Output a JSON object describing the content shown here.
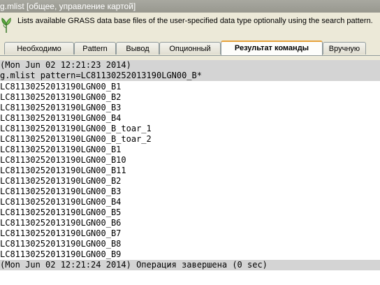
{
  "window": {
    "title": "g.mlist [общее, управление картой]"
  },
  "info": {
    "description": "Lists available GRASS data base files of the user-specified data type optionally using the search pattern.",
    "icon": "grass-leaf-icon"
  },
  "tabs": [
    {
      "label": "Необходимо",
      "active": false
    },
    {
      "label": "Pattern",
      "active": false
    },
    {
      "label": "Вывод",
      "active": false
    },
    {
      "label": "Опционный",
      "active": false
    },
    {
      "label": "Результат команды",
      "active": true
    },
    {
      "label": "Вручную",
      "active": false
    }
  ],
  "console": {
    "start_time": "(Mon Jun 02 12:21:23 2014)",
    "command": "g.mlist pattern=LC81130252013190LGN00_B*",
    "results": [
      "LC81130252013190LGN00_B1",
      "LC81130252013190LGN00_B2",
      "LC81130252013190LGN00_B3",
      "LC81130252013190LGN00_B4",
      "LC81130252013190LGN00_B_toar_1",
      "LC81130252013190LGN00_B_toar_2",
      "LC81130252013190LGN00_B1",
      "LC81130252013190LGN00_B10",
      "LC81130252013190LGN00_B11",
      "LC81130252013190LGN00_B2",
      "LC81130252013190LGN00_B3",
      "LC81130252013190LGN00_B4",
      "LC81130252013190LGN00_B5",
      "LC81130252013190LGN00_B6",
      "LC81130252013190LGN00_B7",
      "LC81130252013190LGN00_B8",
      "LC81130252013190LGN00_B9"
    ],
    "end_status": "(Mon Jun 02 12:21:24 2014) Операция завершена (0 sec)"
  },
  "colors": {
    "titlebar": "#a0a098",
    "highlight": "#d4d4d4",
    "active_tab_accent": "#e6a23a"
  }
}
